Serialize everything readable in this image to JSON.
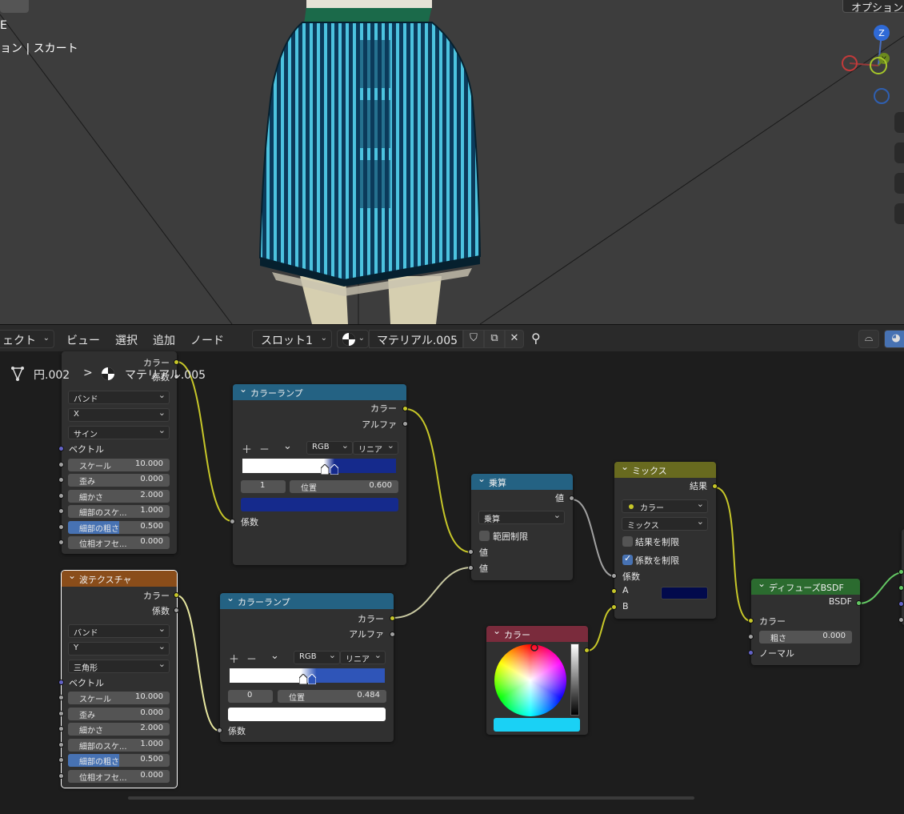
{
  "viewport": {
    "object_text_line1": "E",
    "object_text_line2": "ョン | スカート",
    "options_button": "オプション",
    "gizmo": {
      "z_label": "Z",
      "y_label": "Y"
    }
  },
  "header": {
    "editor_type_label": "ェクト",
    "menus": [
      "ビュー",
      "選択",
      "追加",
      "ノード"
    ],
    "slot_select": "スロット1",
    "material_name": "マテリアル.005"
  },
  "breadcrumb": {
    "object": "円.002",
    "separator": ">",
    "material": "マテリアル.005"
  },
  "nodes": {
    "wave_top": {
      "out_color": "カラー",
      "out_fac": "係数",
      "type": "バンド",
      "direction": "X",
      "profile": "サイン",
      "vector": "ベクトル",
      "fields": [
        {
          "label": "スケール",
          "value": "10.000"
        },
        {
          "label": "歪み",
          "value": "0.000"
        },
        {
          "label": "細かさ",
          "value": "2.000"
        },
        {
          "label": "細部のスケ...",
          "value": "1.000"
        },
        {
          "label": "細部の粗さ",
          "value": "0.500"
        },
        {
          "label": "位相オフセ...",
          "value": "0.000"
        }
      ]
    },
    "ramp_top": {
      "title": "カラーランプ",
      "out_color": "カラー",
      "out_alpha": "アルファ",
      "tools": {
        "add": "＋",
        "remove": "－",
        "menu": "⌄"
      },
      "color_mode": "RGB",
      "interpolation": "リニア",
      "stop_index": "1",
      "position_label": "位置",
      "position_value": "0.600",
      "stop_color": "#152a8c",
      "in_fac": "係数"
    },
    "ramp_bottom": {
      "title": "カラーランプ",
      "out_color": "カラー",
      "out_alpha": "アルファ",
      "tools": {
        "add": "＋",
        "remove": "－",
        "menu": "⌄"
      },
      "color_mode": "RGB",
      "interpolation": "リニア",
      "stop_index": "0",
      "position_label": "位置",
      "position_value": "0.484",
      "stop_color": "#ffffff",
      "in_fac": "係数"
    },
    "wave_bottom": {
      "title": "波テクスチャ",
      "out_color": "カラー",
      "out_fac": "係数",
      "type": "バンド",
      "direction": "Y",
      "profile": "三角形",
      "vector": "ベクトル",
      "fields": [
        {
          "label": "スケール",
          "value": "10.000"
        },
        {
          "label": "歪み",
          "value": "0.000"
        },
        {
          "label": "細かさ",
          "value": "2.000"
        },
        {
          "label": "細部のスケ...",
          "value": "1.000"
        },
        {
          "label": "細部の粗さ",
          "value": "0.500"
        },
        {
          "label": "位相オフセ...",
          "value": "0.000"
        }
      ]
    },
    "math": {
      "title": "乗算",
      "out_value": "値",
      "operation": "乗算",
      "clamp_label": "範囲制限",
      "in_value1": "値",
      "in_value2": "値"
    },
    "mix": {
      "title": "ミックス",
      "out_result": "結果",
      "data_type": "カラー",
      "blend_mode": "ミックス",
      "clamp_result": "結果を制限",
      "clamp_factor": "係数を制限",
      "in_fac": "係数",
      "in_a": "A",
      "in_b": "B",
      "a_color": "#020a4c"
    },
    "color": {
      "title": "カラー",
      "color": "#1ad1f5"
    },
    "diffuse": {
      "title": "ディフューズBSDF",
      "out_bsdf": "BSDF",
      "in_color": "カラー",
      "roughness_label": "粗さ",
      "roughness_value": "0.000",
      "in_normal": "ノーマル"
    }
  }
}
